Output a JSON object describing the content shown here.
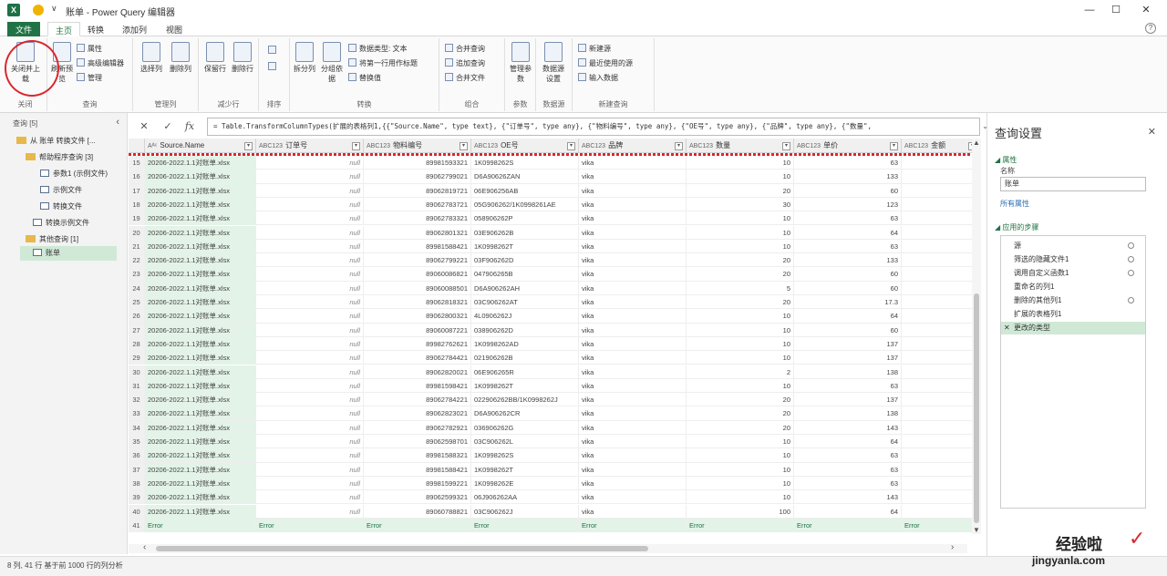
{
  "window": {
    "app_icon": "X",
    "qat_label": "∨",
    "title": "账单 - Power Query 编辑器",
    "controls": {
      "minimize": "—",
      "maximize": "☐",
      "close": "✕"
    }
  },
  "tabs": [
    {
      "label": "文件"
    },
    {
      "label": "主页"
    },
    {
      "label": "转换"
    },
    {
      "label": "添加列"
    },
    {
      "label": "视图"
    }
  ],
  "help_label": "?",
  "ribbon": {
    "close": {
      "button": "关闭并上载",
      "group": "关闭"
    },
    "query": {
      "refresh": "刷新预览",
      "properties": "属性",
      "advanced_editor": "高级编辑器",
      "manage": "管理",
      "group": "查询"
    },
    "manage_cols": {
      "choose": "选择列",
      "remove": "删除列",
      "group": "管理列"
    },
    "reduce_rows": {
      "keep": "保留行",
      "remove": "删除行",
      "group": "减少行"
    },
    "sort": {
      "group": "排序"
    },
    "transform": {
      "split": "拆分列",
      "group_by": "分组依据",
      "data_type": "数据类型: 文本",
      "first_row": "将第一行用作标题",
      "replace": "替换值",
      "group": "转换"
    },
    "combine": {
      "merge": "合并查询",
      "append": "追加查询",
      "merge_files": "合并文件",
      "group": "组合"
    },
    "params": {
      "manage": "管理参数",
      "group": "参数"
    },
    "datasource": {
      "settings": "数据源设置",
      "group": "数据源"
    },
    "new_query": {
      "new_source": "新建源",
      "recent": "最近使用的源",
      "enter_data": "输入数据",
      "group": "新建查询"
    }
  },
  "nav": {
    "header": "查询 [5]",
    "items": [
      {
        "label": "从 账单 转换文件 [..."
      },
      {
        "label": "帮助程序查询 [3]"
      },
      {
        "label": "参数1 (示例文件)"
      },
      {
        "label": "示例文件"
      },
      {
        "label": "转换文件"
      },
      {
        "label": "转换示例文件"
      },
      {
        "label": "其他查询 [1]"
      },
      {
        "label": "账单"
      }
    ]
  },
  "formula": {
    "cancel": "✕",
    "confirm": "✓",
    "fx": "fx",
    "text": "= Table.TransformColumnTypes(扩展的表格列1,{{\"Source.Name\", type text}, {\"订单号\", type any}, {\"物料编号\", type any}, {\"OE号\", type any}, {\"品牌\", type any}, {\"数量\","
  },
  "grid": {
    "columns": [
      {
        "label": "Source.Name",
        "type": "Aᴬᶜ"
      },
      {
        "label": "订单号",
        "type": "ABC123"
      },
      {
        "label": "物料编号",
        "type": "ABC123"
      },
      {
        "label": "OE号",
        "type": "ABC123"
      },
      {
        "label": "品牌",
        "type": "ABC123"
      },
      {
        "label": "数量",
        "type": "ABC123"
      },
      {
        "label": "单价",
        "type": "ABC123"
      },
      {
        "label": "金额",
        "type": "ABC123"
      }
    ],
    "rows": [
      {
        "n": "15",
        "src": "20206-2022.1.1对账单.xlsx",
        "order": "null",
        "mat": "89981593321",
        "oe": "1K0998262S",
        "brand": "vika",
        "qty": "10",
        "price": "63"
      },
      {
        "n": "16",
        "src": "20206-2022.1.1对账单.xlsx",
        "order": "null",
        "mat": "89062799021",
        "oe": "D6A90626ZAN",
        "brand": "vika",
        "qty": "10",
        "price": "133"
      },
      {
        "n": "17",
        "src": "20206-2022.1.1对账单.xlsx",
        "order": "null",
        "mat": "89062819721",
        "oe": "06E906256AB",
        "brand": "vika",
        "qty": "20",
        "price": "60"
      },
      {
        "n": "18",
        "src": "20206-2022.1.1对账单.xlsx",
        "order": "null",
        "mat": "89062783721",
        "oe": "05G906262/1K0998261AE",
        "brand": "vika",
        "qty": "30",
        "price": "123"
      },
      {
        "n": "19",
        "src": "20206-2022.1.1对账单.xlsx",
        "order": "null",
        "mat": "89062783321",
        "oe": "058906262P",
        "brand": "vika",
        "qty": "10",
        "price": "63"
      },
      {
        "n": "20",
        "src": "20206-2022.1.1对账单.xlsx",
        "order": "null",
        "mat": "89062801321",
        "oe": "03E906262B",
        "brand": "vika",
        "qty": "10",
        "price": "64"
      },
      {
        "n": "21",
        "src": "20206-2022.1.1对账单.xlsx",
        "order": "null",
        "mat": "89981588421",
        "oe": "1K0998262T",
        "brand": "vika",
        "qty": "10",
        "price": "63"
      },
      {
        "n": "22",
        "src": "20206-2022.1.1对账单.xlsx",
        "order": "null",
        "mat": "89062799221",
        "oe": "03F906262D",
        "brand": "vika",
        "qty": "20",
        "price": "133"
      },
      {
        "n": "23",
        "src": "20206-2022.1.1对账单.xlsx",
        "order": "null",
        "mat": "89060086821",
        "oe": "047906265B",
        "brand": "vika",
        "qty": "20",
        "price": "60"
      },
      {
        "n": "24",
        "src": "20206-2022.1.1对账单.xlsx",
        "order": "null",
        "mat": "89060088501",
        "oe": "D6A906262AH",
        "brand": "vika",
        "qty": "5",
        "price": "60"
      },
      {
        "n": "25",
        "src": "20206-2022.1.1对账单.xlsx",
        "order": "null",
        "mat": "89062818321",
        "oe": "03C906262AT",
        "brand": "vika",
        "qty": "20",
        "price": "17.3"
      },
      {
        "n": "26",
        "src": "20206-2022.1.1对账单.xlsx",
        "order": "null",
        "mat": "89062800321",
        "oe": "4L0906262J",
        "brand": "vika",
        "qty": "10",
        "price": "64"
      },
      {
        "n": "27",
        "src": "20206-2022.1.1对账单.xlsx",
        "order": "null",
        "mat": "89060087221",
        "oe": "038906262D",
        "brand": "vika",
        "qty": "10",
        "price": "60"
      },
      {
        "n": "28",
        "src": "20206-2022.1.1对账单.xlsx",
        "order": "null",
        "mat": "89982762621",
        "oe": "1K0998262AD",
        "brand": "vika",
        "qty": "10",
        "price": "137"
      },
      {
        "n": "29",
        "src": "20206-2022.1.1对账单.xlsx",
        "order": "null",
        "mat": "89062784421",
        "oe": "021906262B",
        "brand": "vika",
        "qty": "10",
        "price": "137"
      },
      {
        "n": "30",
        "src": "20206-2022.1.1对账单.xlsx",
        "order": "null",
        "mat": "89062820021",
        "oe": "06E906265R",
        "brand": "vika",
        "qty": "2",
        "price": "138"
      },
      {
        "n": "31",
        "src": "20206-2022.1.1对账单.xlsx",
        "order": "null",
        "mat": "89981598421",
        "oe": "1K0998262T",
        "brand": "vika",
        "qty": "10",
        "price": "63"
      },
      {
        "n": "32",
        "src": "20206-2022.1.1对账单.xlsx",
        "order": "null",
        "mat": "89062784221",
        "oe": "022906262BB/1K0998262J",
        "brand": "vika",
        "qty": "20",
        "price": "137"
      },
      {
        "n": "33",
        "src": "20206-2022.1.1对账单.xlsx",
        "order": "null",
        "mat": "89062823021",
        "oe": "D6A906262CR",
        "brand": "vika",
        "qty": "20",
        "price": "138"
      },
      {
        "n": "34",
        "src": "20206-2022.1.1对账单.xlsx",
        "order": "null",
        "mat": "89062782921",
        "oe": "036906262G",
        "brand": "vika",
        "qty": "20",
        "price": "143"
      },
      {
        "n": "35",
        "src": "20206-2022.1.1对账单.xlsx",
        "order": "null",
        "mat": "89062598701",
        "oe": "03C906262L",
        "brand": "vika",
        "qty": "10",
        "price": "64"
      },
      {
        "n": "36",
        "src": "20206-2022.1.1对账单.xlsx",
        "order": "null",
        "mat": "89981588321",
        "oe": "1K0998262S",
        "brand": "vika",
        "qty": "10",
        "price": "63"
      },
      {
        "n": "37",
        "src": "20206-2022.1.1对账单.xlsx",
        "order": "null",
        "mat": "89981588421",
        "oe": "1K0998262T",
        "brand": "vika",
        "qty": "10",
        "price": "63"
      },
      {
        "n": "38",
        "src": "20206-2022.1.1对账单.xlsx",
        "order": "null",
        "mat": "89981599221",
        "oe": "1K0998262E",
        "brand": "vika",
        "qty": "10",
        "price": "63"
      },
      {
        "n": "39",
        "src": "20206-2022.1.1对账单.xlsx",
        "order": "null",
        "mat": "89062599321",
        "oe": "06J906262AA",
        "brand": "vika",
        "qty": "10",
        "price": "143"
      },
      {
        "n": "40",
        "src": "20206-2022.1.1对账单.xlsx",
        "order": "null",
        "mat": "89060788821",
        "oe": "03C906262J",
        "brand": "vika",
        "qty": "100",
        "price": "64"
      }
    ],
    "error_row": {
      "n": "41",
      "value": "Error"
    }
  },
  "status": {
    "text": "8 列, 41 行    基于前 1000 行的列分析"
  },
  "settings": {
    "title": "查询设置",
    "close": "✕",
    "props_section": "◢ 属性",
    "name_label": "名称",
    "name_value": "账单",
    "all_props_link": "所有属性",
    "steps_section": "◢ 应用的步骤",
    "steps": [
      {
        "label": "源",
        "gear": true
      },
      {
        "label": "筛选的隐藏文件1",
        "gear": true
      },
      {
        "label": "调用自定义函数1",
        "gear": true
      },
      {
        "label": "重命名的列1",
        "gear": false
      },
      {
        "label": "删除的其他列1",
        "gear": true
      },
      {
        "label": "扩展的表格列1",
        "gear": false
      },
      {
        "label": "更改的类型",
        "gear": false,
        "selected": true
      }
    ]
  },
  "watermark": {
    "line1": "经验啦",
    "line2": "jingyanla.com",
    "check": "✓"
  },
  "colors": {
    "accent": "#217346",
    "selection": "#cfe9d6",
    "annotation": "#d9272e"
  }
}
